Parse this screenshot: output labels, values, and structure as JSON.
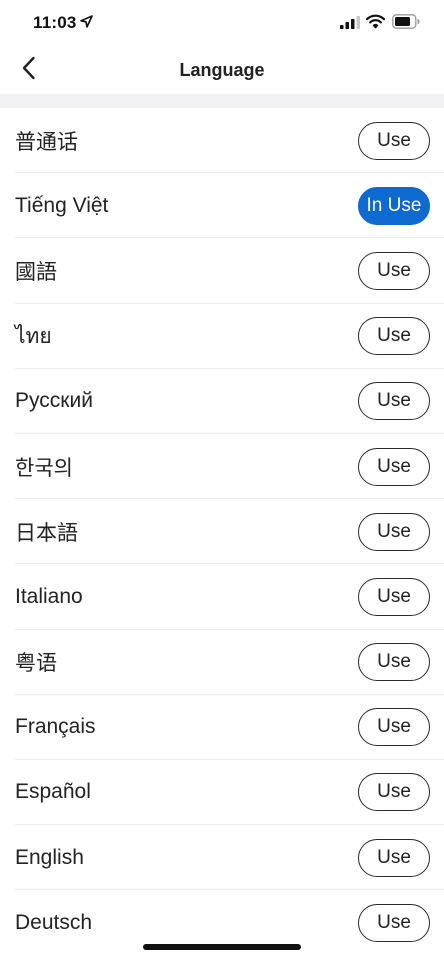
{
  "status_bar": {
    "time": "11:03",
    "icons": [
      "location-arrow-icon",
      "cellular-signal-icon",
      "wifi-icon",
      "battery-icon"
    ]
  },
  "nav": {
    "title": "Language",
    "back_icon": "chevron-left-icon"
  },
  "colors": {
    "accent": "#0e6ad1",
    "divider": "#f2f2f4",
    "button_border": "#2b2b2b"
  },
  "languages": [
    {
      "name": "普通话",
      "button": "Use",
      "in_use": false
    },
    {
      "name": "Tiếng Việt",
      "button": "In Use",
      "in_use": true
    },
    {
      "name": "國語",
      "button": "Use",
      "in_use": false
    },
    {
      "name": "ไทย",
      "button": "Use",
      "in_use": false
    },
    {
      "name": "Русский",
      "button": "Use",
      "in_use": false
    },
    {
      "name": "한국의",
      "button": "Use",
      "in_use": false
    },
    {
      "name": "日本語",
      "button": "Use",
      "in_use": false
    },
    {
      "name": "Italiano",
      "button": "Use",
      "in_use": false
    },
    {
      "name": "粤语",
      "button": "Use",
      "in_use": false
    },
    {
      "name": "Français",
      "button": "Use",
      "in_use": false
    },
    {
      "name": "Español",
      "button": "Use",
      "in_use": false
    },
    {
      "name": "English",
      "button": "Use",
      "in_use": false
    },
    {
      "name": "Deutsch",
      "button": "Use",
      "in_use": false
    }
  ]
}
